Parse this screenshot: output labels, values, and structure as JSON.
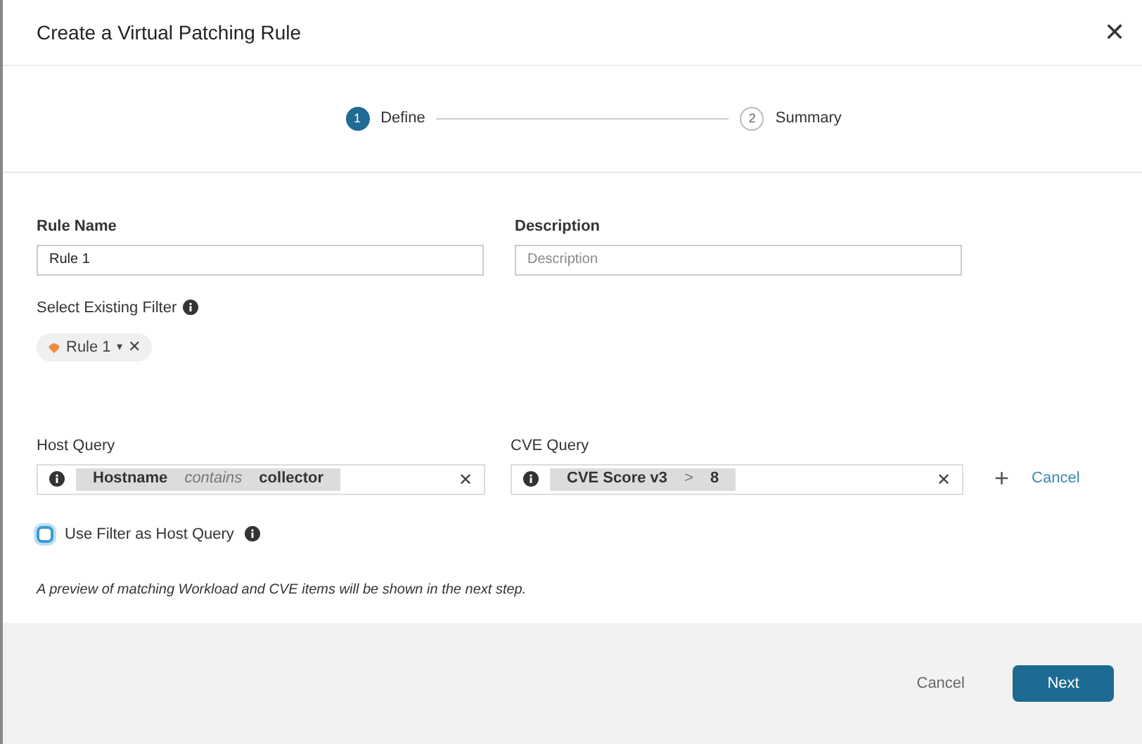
{
  "dialog": {
    "title": "Create a Virtual Patching Rule",
    "close": "✕"
  },
  "steps": [
    {
      "number": "1",
      "label": "Define",
      "selected": true
    },
    {
      "number": "2",
      "label": "Summary",
      "selected": false
    }
  ],
  "rule_name": {
    "label": "Rule Name",
    "value": "Rule 1"
  },
  "description": {
    "label": "Description",
    "placeholder": "Description"
  },
  "existing_filter": {
    "label": "Select Existing Filter",
    "chip": "Rule 1",
    "caret": "▾",
    "remove": "✕"
  },
  "host_query": {
    "label": "Host Query",
    "clear": "✕",
    "tokens": [
      {
        "kind": "field",
        "text": "Hostname"
      },
      {
        "kind": "operator",
        "text": "contains"
      },
      {
        "kind": "value",
        "text": "collector"
      }
    ]
  },
  "cve_query": {
    "label": "CVE Query",
    "clear": "✕",
    "tokens": [
      {
        "kind": "field",
        "text": "CVE Score v3"
      },
      {
        "kind": "operator",
        "text": ">"
      },
      {
        "kind": "value",
        "text": "8"
      }
    ]
  },
  "add": "+",
  "cancel_link": "Cancel",
  "use_filter": {
    "label": "Use Filter as Host Query",
    "checked": false
  },
  "note": "A preview of matching Workload and CVE items will be shown in the next step.",
  "footer": {
    "cancel": "Cancel",
    "next": "Next"
  }
}
